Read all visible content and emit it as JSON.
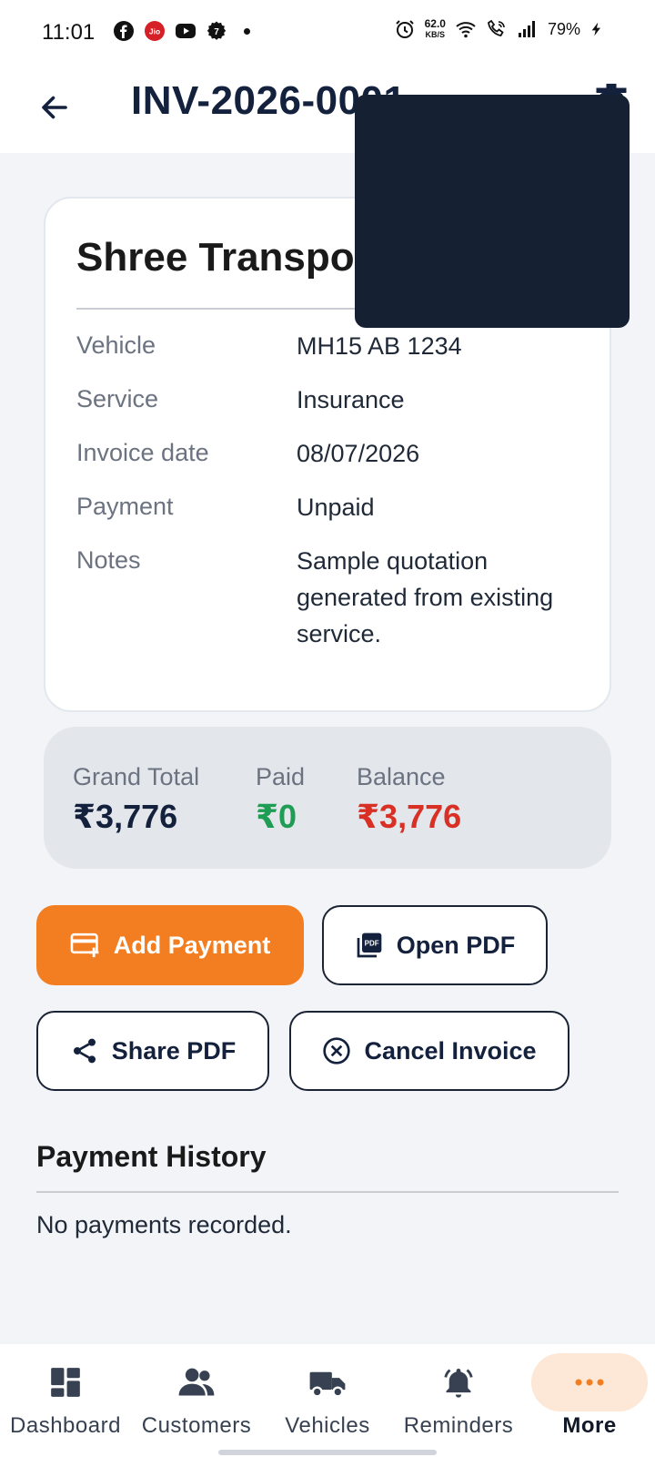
{
  "status_bar": {
    "time": "11:01",
    "net_speed_value": "62.0",
    "net_speed_unit": "KB/S",
    "battery": "79%"
  },
  "app_bar": {
    "title": "INV-2026-0001"
  },
  "invoice": {
    "customer_name": "Shree Transport",
    "details": [
      {
        "label": "Vehicle",
        "value": "MH15 AB 1234"
      },
      {
        "label": "Service",
        "value": "Insurance"
      },
      {
        "label": "Invoice date",
        "value": "08/07/2026"
      },
      {
        "label": "Payment",
        "value": "Unpaid"
      },
      {
        "label": "Notes",
        "value": "Sample quotation generated from existing service."
      }
    ]
  },
  "summary": {
    "grand_total_label": "Grand Total",
    "grand_total_value": "₹3,776",
    "paid_label": "Paid",
    "paid_value": "₹0",
    "balance_label": "Balance",
    "balance_value": "₹3,776"
  },
  "actions": {
    "add_payment": "Add Payment",
    "open_pdf": "Open PDF",
    "share_pdf": "Share PDF",
    "cancel_invoice": "Cancel Invoice"
  },
  "payment_history": {
    "title": "Payment History",
    "empty_text": "No payments recorded."
  },
  "bottom_nav": {
    "items": [
      {
        "label": "Dashboard",
        "icon": "dashboard-icon"
      },
      {
        "label": "Customers",
        "icon": "people-icon"
      },
      {
        "label": "Vehicles",
        "icon": "truck-icon"
      },
      {
        "label": "Reminders",
        "icon": "bell-icon"
      },
      {
        "label": "More",
        "icon": "more-icon"
      }
    ]
  },
  "colors": {
    "accent": "#f37e21",
    "navy": "#14213d",
    "paid_green": "#1f9d55",
    "balance_red": "#d93025"
  }
}
